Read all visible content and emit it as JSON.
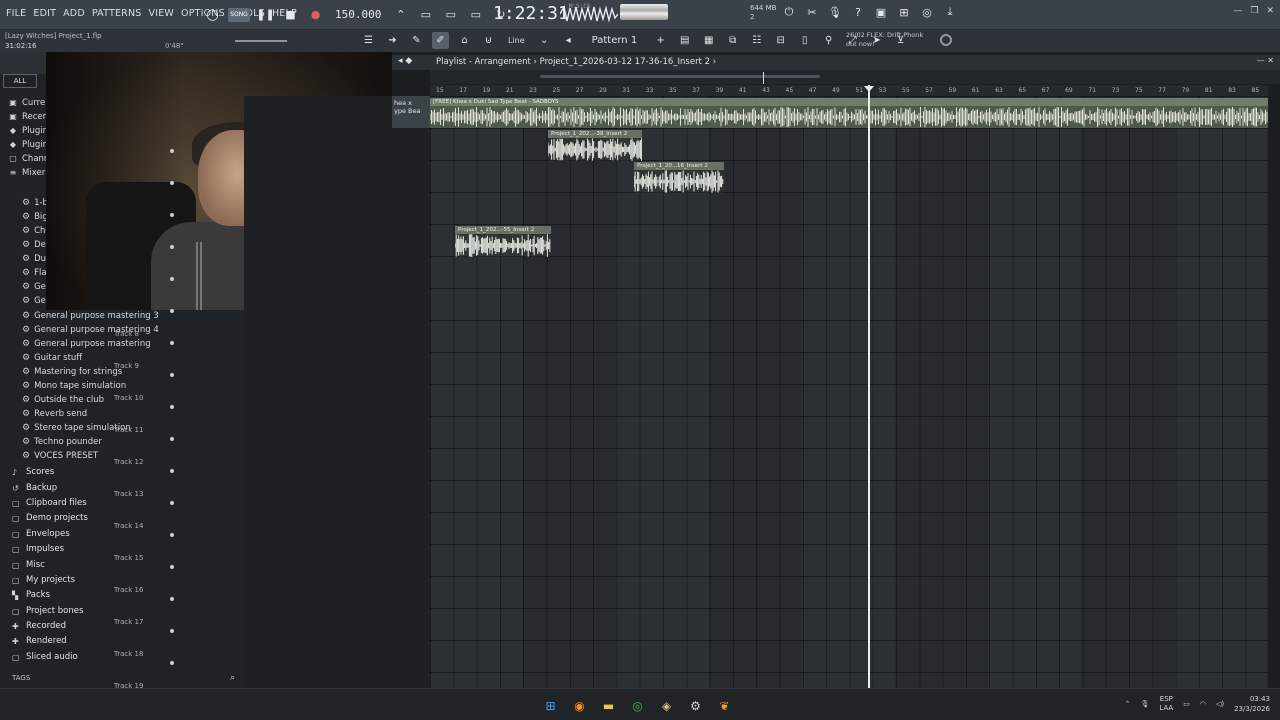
{
  "menu": [
    "FILE",
    "EDIT",
    "ADD",
    "PATTERNS",
    "VIEW",
    "OPTIONS",
    "TOOLS",
    "HELP"
  ],
  "transport": {
    "mode": "SONG",
    "tempo": "150.000",
    "time": "1:22:31",
    "time_label": "M:S:CS"
  },
  "cpu": {
    "ram": "644 MB",
    "poly": "2"
  },
  "project": {
    "title": "[Lazy Witches] Project_1.flp",
    "elapsed": "31:02:16",
    "mini_time": "0'48\""
  },
  "toolbar": {
    "snap": "Line",
    "pattern": "Pattern 1"
  },
  "news": {
    "line1": "26/02  FLEX: Drift Phonk",
    "line2": "out now!"
  },
  "browser": {
    "all_label": "ALL",
    "top_items": [
      {
        "icon": "folder",
        "label": "Curre"
      },
      {
        "icon": "folder",
        "label": "Recen"
      },
      {
        "icon": "folder",
        "label": "Plugin"
      },
      {
        "icon": "folder",
        "label": "Plugin"
      },
      {
        "icon": "folder",
        "label": "Chann"
      },
      {
        "icon": "folder",
        "label": "Mixer"
      }
    ],
    "mixer_presets_partial": [
      "1-b",
      "Big",
      "Cho",
      "Def",
      "Dua",
      "Flan",
      "Ger",
      "Ger"
    ],
    "mixer_presets": [
      "General purpose mastering 3",
      "General purpose mastering 4",
      "General purpose mastering",
      "Guitar stuff",
      "Mastering for strings",
      "Mono tape simulation",
      "Outside the club",
      "Reverb send",
      "Stereo tape simulation",
      "Techno pounder",
      "VOCES PRESET"
    ],
    "folders": [
      {
        "icon": "note",
        "label": "Scores"
      },
      {
        "icon": "backup",
        "label": "Backup"
      },
      {
        "icon": "folder",
        "label": "Clipboard files"
      },
      {
        "icon": "folder",
        "label": "Demo projects"
      },
      {
        "icon": "folder",
        "label": "Envelopes"
      },
      {
        "icon": "folder",
        "label": "Impulses"
      },
      {
        "icon": "folder",
        "label": "Misc"
      },
      {
        "icon": "folder",
        "label": "My projects"
      },
      {
        "icon": "pack",
        "label": "Packs"
      },
      {
        "icon": "folder",
        "label": "Project bones"
      },
      {
        "icon": "plus",
        "label": "Recorded"
      },
      {
        "icon": "plus",
        "label": "Rendered"
      },
      {
        "icon": "folder",
        "label": "Sliced audio"
      }
    ],
    "tags_label": "TAGS"
  },
  "playlist": {
    "title": "Playlist - Arrangement › Project_1_2026-03-12 17-36-16_Insert 2 ›",
    "ruler": [
      "15",
      "17",
      "19",
      "21",
      "23",
      "25",
      "27",
      "29",
      "31",
      "33",
      "35",
      "37",
      "39",
      "41",
      "43",
      "45",
      "47",
      "49",
      "51",
      "53",
      "55",
      "57",
      "59",
      "61",
      "63",
      "65",
      "67",
      "69",
      "71",
      "73",
      "75",
      "77",
      "79",
      "81",
      "83",
      "85"
    ],
    "track1_header": "hea x\nype Bea",
    "tracks": [
      "Track 8",
      "Track 9",
      "Track 10",
      "Track 11",
      "Track 12",
      "Track 13",
      "Track 14",
      "Track 15",
      "Track 16",
      "Track 17",
      "Track 18",
      "Track 19"
    ],
    "clips": [
      {
        "label": "[FREE] Khea x Duki Sad Type Beat - SADBOYS",
        "track": 1
      },
      {
        "label": "Project_1_202...-38_Insert 2",
        "track": 2
      },
      {
        "label": "Project_1_20...16_Insert 2",
        "track": 3
      },
      {
        "label": "Project_1_202...-55_Insert 2",
        "track": 5
      }
    ]
  },
  "taskbar": {
    "lang_1": "ESP",
    "lang_2": "LAA",
    "time": "03:43",
    "date": "23/3/2026",
    "icons": [
      "windows-icon",
      "firefox-icon",
      "explorer-icon",
      "chrome-icon",
      "app-icon",
      "settings-icon",
      "fl-studio-icon"
    ]
  }
}
